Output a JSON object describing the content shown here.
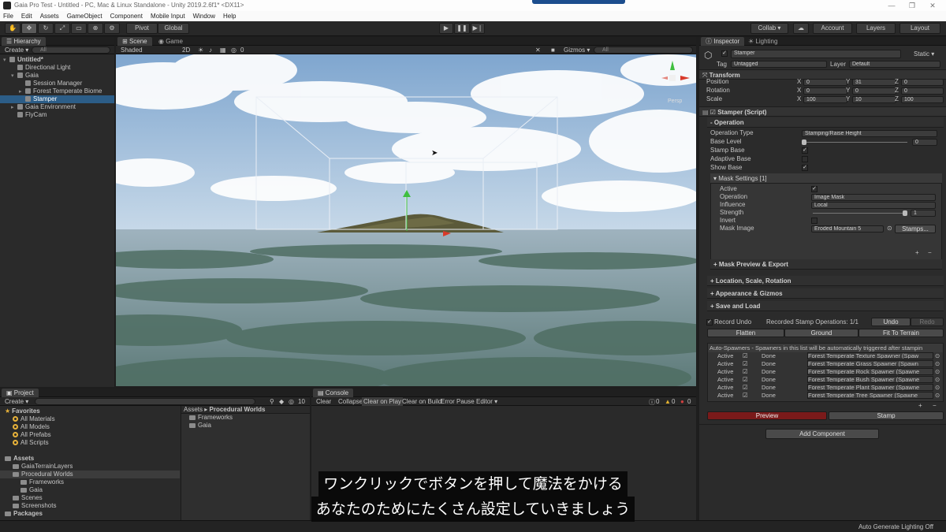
{
  "window": {
    "title": "Gaia Pro Test - Untitled - PC, Mac & Linux Standalone - Unity 2019.2.6f1* <DX11>"
  },
  "menu": [
    "File",
    "Edit",
    "Assets",
    "GameObject",
    "Component",
    "Mobile Input",
    "Window",
    "Help"
  ],
  "toolbar": {
    "pivot": "Pivot",
    "global": "Global",
    "collab": "Collab ▾",
    "account": "Account",
    "layers": "Layers",
    "layout": "Layout"
  },
  "hierarchy": {
    "tab": "Hierarchy",
    "create": "Create ▾",
    "search": "All",
    "items": [
      {
        "label": "Untitled*",
        "indent": 0,
        "bold": true,
        "arrow": "▾"
      },
      {
        "label": "Directional Light",
        "indent": 1,
        "arrow": ""
      },
      {
        "label": "Gaia",
        "indent": 1,
        "arrow": "▾"
      },
      {
        "label": "Session Manager",
        "indent": 2,
        "arrow": ""
      },
      {
        "label": "Forest Temperate Biome",
        "indent": 2,
        "arrow": "▸"
      },
      {
        "label": "Stamper",
        "indent": 2,
        "arrow": "",
        "selected": true
      },
      {
        "label": "Gaia Environment",
        "indent": 1,
        "arrow": "▸"
      },
      {
        "label": "FlyCam",
        "indent": 1,
        "arrow": ""
      }
    ]
  },
  "scene": {
    "tab_scene": "Scene",
    "tab_game": "Game",
    "shading": "Shaded",
    "mode": "2D",
    "fx_count": "0",
    "gizmos": "Gizmos ▾",
    "search": "All",
    "persp": "Persp"
  },
  "project": {
    "tab": "Project",
    "create": "Create ▾",
    "count": "10",
    "tree": [
      {
        "label": "Favorites",
        "type": "star",
        "indent": 0,
        "bold": true
      },
      {
        "label": "All Materials",
        "type": "mag",
        "indent": 1
      },
      {
        "label": "All Models",
        "type": "mag",
        "indent": 1
      },
      {
        "label": "All Prefabs",
        "type": "mag",
        "indent": 1
      },
      {
        "label": "All Scripts",
        "type": "mag",
        "indent": 1
      },
      {
        "label": "",
        "type": "gap",
        "indent": 0
      },
      {
        "label": "Assets",
        "type": "folder",
        "indent": 0,
        "bold": true
      },
      {
        "label": "GaiaTerrainLayers",
        "type": "folder",
        "indent": 1
      },
      {
        "label": "Procedural Worlds",
        "type": "folder",
        "indent": 1,
        "selected": true
      },
      {
        "label": "Frameworks",
        "type": "folder",
        "indent": 2
      },
      {
        "label": "Gaia",
        "type": "folder",
        "indent": 2
      },
      {
        "label": "Scenes",
        "type": "folder",
        "indent": 1
      },
      {
        "label": "Screenshots",
        "type": "folder",
        "indent": 1
      },
      {
        "label": "Packages",
        "type": "folder",
        "indent": 0,
        "bold": true
      }
    ],
    "breadcrumb_root": "Assets",
    "breadcrumb_sep": "▸",
    "breadcrumb_current": "Procedural Worlds",
    "files": [
      "Frameworks",
      "Gaia"
    ]
  },
  "console": {
    "tab": "Console",
    "buttons": [
      "Clear",
      "Collapse",
      "Clear on Play",
      "Clear on Build",
      "Error Pause",
      "Editor ▾"
    ],
    "counts": [
      "0",
      "0",
      "0"
    ]
  },
  "inspector": {
    "tab": "Inspector",
    "tab2": "Lighting",
    "object_name": "Stamper",
    "static": "Static ▾",
    "tag_label": "Tag",
    "tag": "Untagged",
    "layer_label": "Layer",
    "layer": "Default",
    "transform": {
      "title": "Transform",
      "position": {
        "label": "Position",
        "x": "0",
        "y": "31",
        "z": "0"
      },
      "rotation": {
        "label": "Rotation",
        "x": "0",
        "y": "0",
        "z": "0"
      },
      "scale": {
        "label": "Scale",
        "x": "100",
        "y": "10",
        "z": "100"
      }
    },
    "script_title": "Stamper (Script)",
    "operation_header": "Operation",
    "operation_type_label": "Operation Type",
    "operation_type": "Stamping/Raise Height",
    "base_level_label": "Base Level",
    "base_level": "0",
    "stamp_base_label": "Stamp Base",
    "adaptive_base_label": "Adaptive Base",
    "show_base_label": "Show Base",
    "mask_settings": "Mask Settings [1]",
    "active_label": "Active",
    "operation_label": "Operation",
    "operation": "Image Mask",
    "influence_label": "Influence",
    "influence": "Local",
    "strength_label": "Strength",
    "strength": "1",
    "invert_label": "Invert",
    "mask_image_label": "Mask Image",
    "mask_image": "Eroded Mountain 5",
    "stamps_button": "Stamps...",
    "mask_preview": "Mask Preview & Export",
    "location": "Location, Scale, Rotation",
    "appearance": "Appearance & Gizmos",
    "save_load": "Save and Load",
    "record_undo": "Record Undo",
    "recorded_ops": "Recorded Stamp Operations: 1/1",
    "undo": "Undo",
    "redo": "Redo",
    "flatten": "Flatten",
    "ground": "Ground",
    "fit_terrain": "Fit To Terrain",
    "autospawners_header": "Auto-Spawners - Spawners in this list will be automatically triggered after stampin",
    "spawners": [
      {
        "active": "Active",
        "done": "Done",
        "name": "Forest Temperate Texture Spawner (Spaw"
      },
      {
        "active": "Active",
        "done": "Done",
        "name": "Forest Temperate Grass Spawner (Spawn"
      },
      {
        "active": "Active",
        "done": "Done",
        "name": "Forest Temperate Rock Spawner (Spawne"
      },
      {
        "active": "Active",
        "done": "Done",
        "name": "Forest Temperate Bush Spawner (Spawne"
      },
      {
        "active": "Active",
        "done": "Done",
        "name": "Forest Temperate Plant Spawner (Spawne"
      },
      {
        "active": "Active",
        "done": "Done",
        "name": "Forest Temperate Tree Spawner (Spawne"
      }
    ],
    "preview": "Preview",
    "stamp": "Stamp",
    "add_component": "Add Component"
  },
  "statusbar": {
    "right": "Auto Generate Lighting Off"
  },
  "subtitles": [
    "ワンクリックでボタンを押して魔法をかける",
    "あなたのためにたくさん設定していきましょう"
  ],
  "colors": {
    "selection": "#2c5d87",
    "preview_button": "#7a1a1a",
    "accent": "#1c4e8e"
  }
}
